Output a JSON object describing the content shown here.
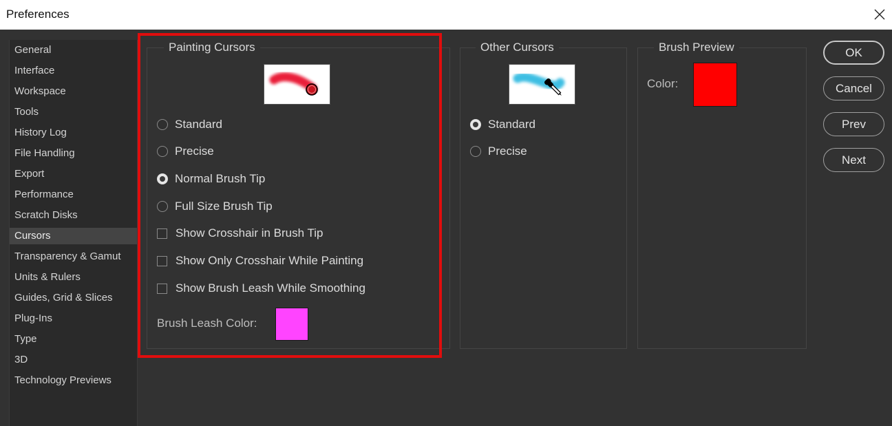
{
  "window": {
    "title": "Preferences"
  },
  "sidebar": {
    "items": [
      {
        "label": "General"
      },
      {
        "label": "Interface"
      },
      {
        "label": "Workspace"
      },
      {
        "label": "Tools"
      },
      {
        "label": "History Log"
      },
      {
        "label": "File Handling"
      },
      {
        "label": "Export"
      },
      {
        "label": "Performance"
      },
      {
        "label": "Scratch Disks"
      },
      {
        "label": "Cursors",
        "selected": true
      },
      {
        "label": "Transparency & Gamut"
      },
      {
        "label": "Units & Rulers"
      },
      {
        "label": "Guides, Grid & Slices"
      },
      {
        "label": "Plug-Ins"
      },
      {
        "label": "Type"
      },
      {
        "label": "3D"
      },
      {
        "label": "Technology Previews"
      }
    ]
  },
  "painting_cursors": {
    "label": "Painting Cursors",
    "preview_icon": "brush-stroke-circle-cursor-icon",
    "options": [
      {
        "label": "Standard",
        "type": "radio",
        "selected": false
      },
      {
        "label": "Precise",
        "type": "radio",
        "selected": false
      },
      {
        "label": "Normal Brush Tip",
        "type": "radio",
        "selected": true
      },
      {
        "label": "Full Size Brush Tip",
        "type": "radio",
        "selected": false
      },
      {
        "label": "Show Crosshair in Brush Tip",
        "type": "checkbox",
        "checked": false
      },
      {
        "label": "Show Only Crosshair While Painting",
        "type": "checkbox",
        "checked": false
      },
      {
        "label": "Show Brush Leash While Smoothing",
        "type": "checkbox",
        "checked": false
      }
    ],
    "leash_color_label": "Brush Leash Color:",
    "leash_color": "#ff44ff"
  },
  "other_cursors": {
    "label": "Other Cursors",
    "preview_icon": "eyedropper-cursor-icon",
    "options": [
      {
        "label": "Standard",
        "type": "radio",
        "selected": true
      },
      {
        "label": "Precise",
        "type": "radio",
        "selected": false
      }
    ]
  },
  "brush_preview": {
    "label": "Brush Preview",
    "color_label": "Color:",
    "color": "#ff0000"
  },
  "buttons": {
    "ok": "OK",
    "cancel": "Cancel",
    "prev": "Prev",
    "next": "Next"
  },
  "colors": {
    "highlight": "#e00d0d",
    "panel_bg": "#323232",
    "stroke_red": "#e8102a",
    "stroke_cyan": "#2ab8e0"
  }
}
